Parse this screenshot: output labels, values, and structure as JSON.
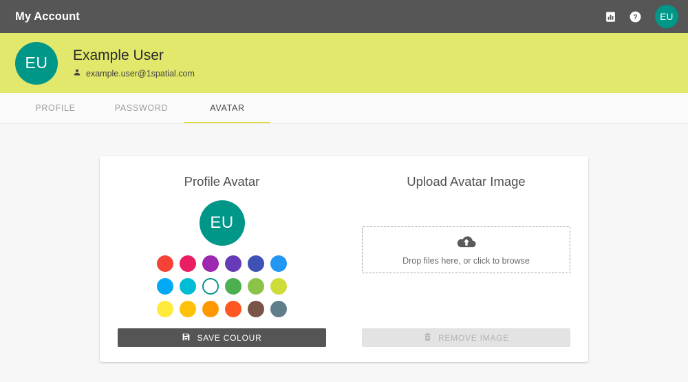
{
  "appbar": {
    "title": "My Account",
    "icons": [
      {
        "name": "chart-icon",
        "label": ""
      },
      {
        "name": "help-icon",
        "label": ""
      }
    ],
    "avatar_initials": "EU"
  },
  "banner": {
    "avatar_initials": "EU",
    "name": "Example User",
    "email": "example.user@1spatial.com",
    "background_color": "#E2E86B",
    "avatar_color": "#009688"
  },
  "tabs": [
    {
      "label": "PROFILE",
      "active": false
    },
    {
      "label": "PASSWORD",
      "active": false
    },
    {
      "label": "AVATAR",
      "active": true
    }
  ],
  "tab_accent_color": "#DCDC3C",
  "avatar_panel": {
    "title": "Profile Avatar",
    "preview_initials": "EU",
    "preview_color": "#009688",
    "selected_index": 8,
    "selected_ring_color": "#009688",
    "swatches": [
      "#F44336",
      "#E91E63",
      "#9C27B0",
      "#673AB7",
      "#3F51B5",
      "#2196F3",
      "#03A9F4",
      "#00BCD4",
      "#009688",
      "#4CAF50",
      "#8BC34A",
      "#CDDC39",
      "#FFEB3B",
      "#FFC107",
      "#FF9800",
      "#FF5722",
      "#795548",
      "#607D8B"
    ],
    "save_button_label": "SAVE COLOUR",
    "save_button_icon": "save-icon"
  },
  "upload_panel": {
    "title": "Upload Avatar Image",
    "dropzone_text": "Drop files here, or click to browse",
    "dropzone_icon": "cloud-upload-icon",
    "remove_button_label": "REMOVE IMAGE",
    "remove_button_icon": "trash-icon",
    "remove_button_disabled": true
  }
}
